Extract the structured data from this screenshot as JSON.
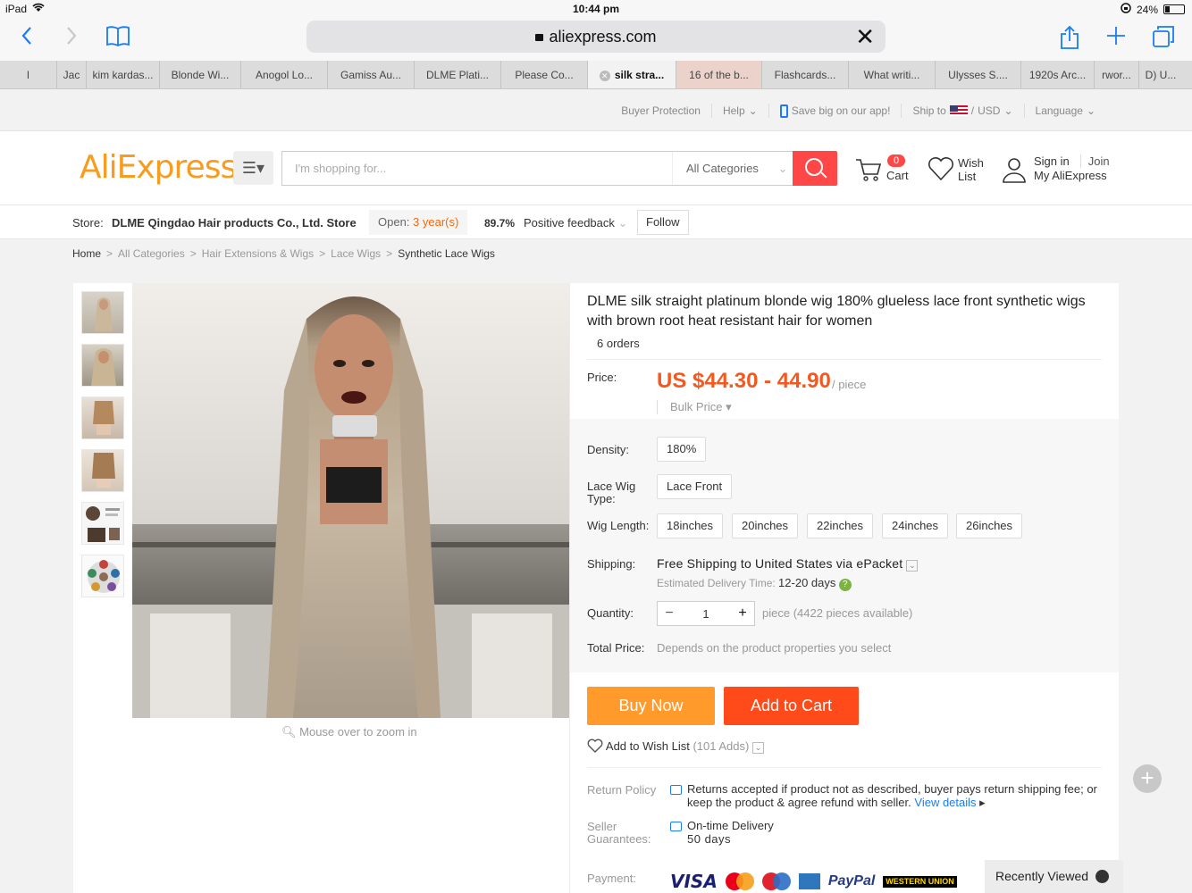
{
  "status_bar": {
    "device": "iPad",
    "time": "10:44 pm",
    "battery": "24%",
    "battery_level": 0.24
  },
  "safari": {
    "url": "aliexpress.com"
  },
  "tabs": [
    {
      "label": "l"
    },
    {
      "label": "Jac"
    },
    {
      "label": "kim kardas..."
    },
    {
      "label": "Blonde Wi..."
    },
    {
      "label": "Anogol Lo..."
    },
    {
      "label": "Gamiss Au..."
    },
    {
      "label": "DLME Plati..."
    },
    {
      "label": "Please Co..."
    },
    {
      "label": "silk stra..."
    },
    {
      "label": "16 of the b..."
    },
    {
      "label": "Flashcards..."
    },
    {
      "label": "What writi..."
    },
    {
      "label": "Ulysses S...."
    },
    {
      "label": "1920s Arc..."
    },
    {
      "label": "rwor..."
    },
    {
      "label": "D) U..."
    }
  ],
  "topbar": {
    "buyer_protection": "Buyer Protection",
    "help": "Help",
    "app": "Save big on our app!",
    "ship_to": "Ship to",
    "currency": "USD",
    "language": "Language"
  },
  "header": {
    "logo_main": "AliExpress",
    "search_placeholder": "I'm shopping for...",
    "category": "All Categories",
    "cart_count": "0",
    "cart_label": "Cart",
    "wish_label_1": "Wish",
    "wish_label_2": "List",
    "sign_in": "Sign in",
    "join": "Join",
    "my_account": "My AliExpress"
  },
  "store": {
    "label": "Store:",
    "name": "DLME Qingdao Hair products Co., Ltd. Store",
    "open_prefix": "Open:",
    "open_years": "3 year(s)",
    "feedback_pct": "89.7%",
    "feedback_label": "Positive feedback",
    "follow": "Follow"
  },
  "breadcrumb": [
    "Home",
    "All Categories",
    "Hair Extensions & Wigs",
    "Lace Wigs",
    "Synthetic Lace Wigs"
  ],
  "product": {
    "title": "DLME silk straight platinum blonde wig 180% glueless lace front synthetic wigs with brown root heat resistant hair for women",
    "orders": "6 orders",
    "price_label": "Price:",
    "price": "US $44.30 - 44.90",
    "unit": "/ piece",
    "bulk": "Bulk Price",
    "zoom_hint": "Mouse over to zoom in",
    "density_label": "Density:",
    "density": "180%",
    "lace_label_1": "Lace Wig",
    "lace_label_2": "Type:",
    "lace_type": "Lace Front",
    "length_label": "Wig Length:",
    "lengths": [
      "18inches",
      "20inches",
      "22inches",
      "24inches",
      "26inches"
    ],
    "shipping_label": "Shipping:",
    "shipping": "Free Shipping to United States via ePacket",
    "delivery_label": "Estimated Delivery Time:",
    "delivery": "12-20 days",
    "quantity_label": "Quantity:",
    "quantity": "1",
    "available": "piece (4422 pieces available)",
    "total_label": "Total Price:",
    "total": "Depends on the product properties you select",
    "buy_now": "Buy Now",
    "add_to_cart": "Add to Cart",
    "wish": "Add to Wish List",
    "wish_adds": "(101 Adds)",
    "return_label": "Return Policy",
    "return_text": "Returns accepted if product not as described, buyer pays return shipping fee; or keep the product & agree refund with seller.",
    "view_details": "View details",
    "seller_label_1": "Seller",
    "seller_label_2": "Guarantees:",
    "ontime": "On-time Delivery",
    "ontime_days": "50 days",
    "payment_label": "Payment:",
    "payment_methods": [
      "VISA",
      "PayPal",
      "WESTERN UNION"
    ]
  },
  "recently_viewed": "Recently Viewed",
  "colors": {
    "brand_red": "#e62e04",
    "price": "#f2581f",
    "buy": "#ff9a2b",
    "cart": "#ff4b1a"
  }
}
